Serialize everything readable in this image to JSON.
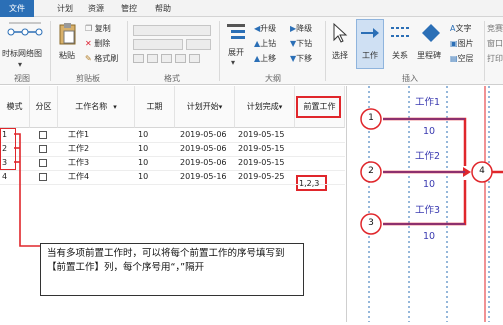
{
  "menu": {
    "tabs": [
      "文件",
      "计划",
      "资源",
      "管控",
      "帮助"
    ]
  },
  "ribbon": {
    "groups": [
      "视图",
      "剪贴板",
      "格式",
      "大纲",
      "插入"
    ],
    "view": {
      "timescale_label": "时标网络图"
    },
    "clipboard": {
      "paste": "粘贴",
      "copy": "复制",
      "delete": "删除",
      "format_brush": "格式刷"
    },
    "outline": {
      "expand": "展开",
      "upgrade": "升级",
      "downgrade": "降级",
      "move_up": "上钻",
      "drill_down": "下钻",
      "move_up2": "上移",
      "move_down": "下移"
    },
    "insert": {
      "select": "选择",
      "work": "工作",
      "relation": "关系",
      "milestone": "里程碑",
      "text": "文字",
      "image": "图片",
      "blank": "空层",
      "far_right_1": "竞赛",
      "far_right_2": "窗口",
      "far_right_3": "打印"
    },
    "accent": "#2b6fb6"
  },
  "grid": {
    "columns": [
      "模式",
      "分区",
      "工作名称",
      "工期",
      "计划开始",
      "计划完成",
      "前置工作"
    ],
    "row_numbers": [
      "1",
      "2",
      "3",
      "4"
    ],
    "rows": [
      {
        "name": "工作1",
        "duration": "10",
        "start": "2019-05-06",
        "finish": "2019-05-15",
        "pred": ""
      },
      {
        "name": "工作2",
        "duration": "10",
        "start": "2019-05-06",
        "finish": "2019-05-15",
        "pred": ""
      },
      {
        "name": "工作3",
        "duration": "10",
        "start": "2019-05-06",
        "finish": "2019-05-15",
        "pred": ""
      },
      {
        "name": "工作4",
        "duration": "10",
        "start": "2019-05-16",
        "finish": "2019-05-25",
        "pred": "1,2,3"
      }
    ]
  },
  "callout": {
    "text": "当有多项前置工作时，可以将每个前置工作的序号填写到【前置工作】列，每个序号用“，”隔开"
  },
  "network": {
    "nodes": [
      "1",
      "2",
      "3",
      "4"
    ],
    "labels": [
      "工作1",
      "工作2",
      "工作3"
    ],
    "durations": [
      "10",
      "10",
      "10"
    ]
  },
  "colors": {
    "highlight": "#e0262b",
    "link": "#3a3ab0"
  }
}
